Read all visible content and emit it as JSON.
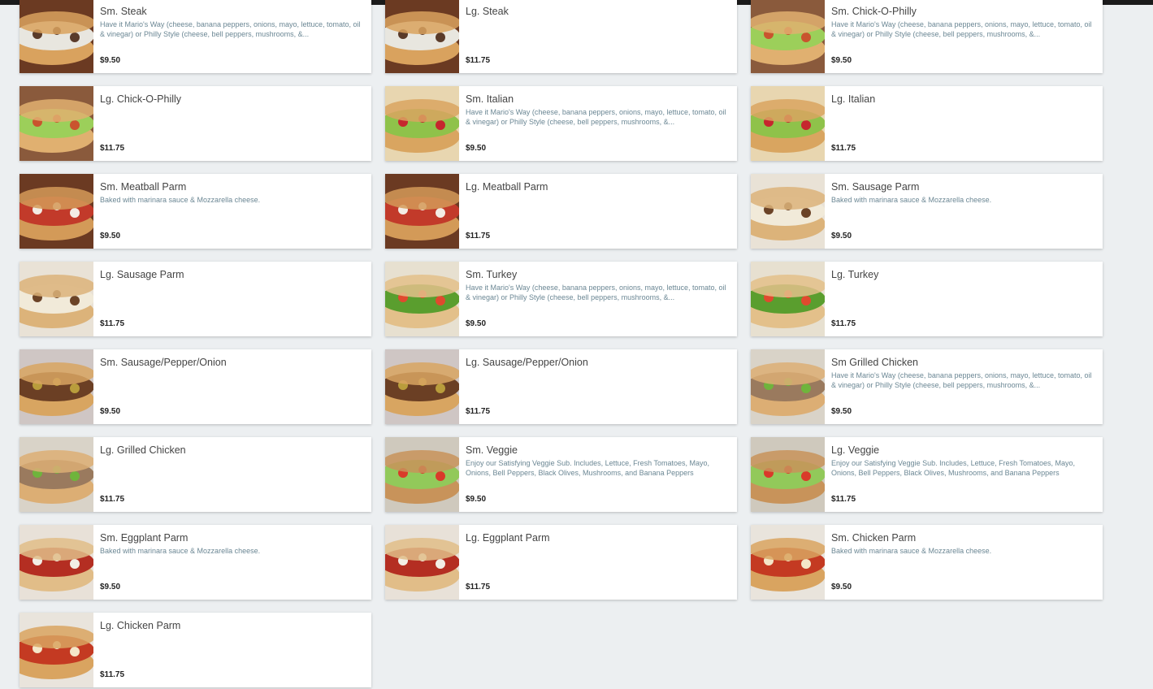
{
  "menu": {
    "items": [
      {
        "name": "Sm. Steak",
        "description": "Have it Mario's Way (cheese, banana peppers, onions, mayo, lettuce, tomato, oil & vinegar) or Philly Style (cheese, bell peppers, mushrooms, &...",
        "price": "$9.50",
        "image": "steak"
      },
      {
        "name": "Lg. Steak",
        "description": "",
        "price": "$11.75",
        "image": "steak"
      },
      {
        "name": "Sm. Chick-O-Philly",
        "description": "Have it Mario's Way (cheese, banana peppers, onions, mayo, lettuce, tomato, oil & vinegar) or Philly Style (cheese, bell peppers, mushrooms, &...",
        "price": "$9.50",
        "image": "chick"
      },
      {
        "name": "Lg. Chick-O-Philly",
        "description": "",
        "price": "$11.75",
        "image": "chick"
      },
      {
        "name": "Sm. Italian",
        "description": "Have it Mario's Way (cheese, banana peppers, onions, mayo, lettuce, tomato, oil & vinegar) or Philly Style (cheese, bell peppers, mushrooms, &...",
        "price": "$9.50",
        "image": "italian"
      },
      {
        "name": "Lg. Italian",
        "description": "",
        "price": "$11.75",
        "image": "italian"
      },
      {
        "name": "Sm. Meatball Parm",
        "description": "Baked with marinara sauce & Mozzarella cheese.",
        "price": "$9.50",
        "image": "meatball"
      },
      {
        "name": "Lg. Meatball Parm",
        "description": "",
        "price": "$11.75",
        "image": "meatball"
      },
      {
        "name": "Sm. Sausage Parm",
        "description": "Baked with marinara sauce & Mozzarella cheese.",
        "price": "$9.50",
        "image": "sausage"
      },
      {
        "name": "Lg. Sausage Parm",
        "description": "",
        "price": "$11.75",
        "image": "sausage"
      },
      {
        "name": "Sm. Turkey",
        "description": "Have it Mario's Way (cheese, banana peppers, onions, mayo, lettuce, tomato, oil & vinegar) or Philly Style (cheese, bell peppers, mushrooms, &...",
        "price": "$9.50",
        "image": "turkey"
      },
      {
        "name": "Lg. Turkey",
        "description": "",
        "price": "$11.75",
        "image": "turkey"
      },
      {
        "name": "Sm. Sausage/Pepper/Onion",
        "description": "",
        "price": "$9.50",
        "image": "spo"
      },
      {
        "name": "Lg. Sausage/Pepper/Onion",
        "description": "",
        "price": "$11.75",
        "image": "spo"
      },
      {
        "name": "Sm Grilled Chicken",
        "description": "Have it Mario's Way (cheese, banana peppers, onions, mayo, lettuce, tomato, oil & vinegar) or Philly Style (cheese, bell peppers, mushrooms, &...",
        "price": "$9.50",
        "image": "grilled"
      },
      {
        "name": "Lg. Grilled Chicken",
        "description": "",
        "price": "$11.75",
        "image": "grilled"
      },
      {
        "name": "Sm. Veggie",
        "description": "Enjoy our Satisfying Veggie Sub. Includes, Lettuce, Fresh Tomatoes, Mayo, Onions, Bell Peppers, Black Olives, Mushrooms, and Banana Peppers",
        "price": "$9.50",
        "image": "veggie"
      },
      {
        "name": "Lg. Veggie",
        "description": "Enjoy our Satisfying Veggie Sub. Includes, Lettuce, Fresh Tomatoes, Mayo, Onions, Bell Peppers, Black Olives, Mushrooms, and Banana Peppers",
        "price": "$11.75",
        "image": "veggie"
      },
      {
        "name": "Sm. Eggplant Parm",
        "description": "Baked with marinara sauce & Mozzarella cheese.",
        "price": "$9.50",
        "image": "eggplant"
      },
      {
        "name": "Lg. Eggplant Parm",
        "description": "",
        "price": "$11.75",
        "image": "eggplant"
      },
      {
        "name": "Sm. Chicken Parm",
        "description": "Baked with marinara sauce & Mozzarella cheese.",
        "price": "$9.50",
        "image": "chickenparm"
      },
      {
        "name": "Lg. Chicken Parm",
        "description": "",
        "price": "$11.75",
        "image": "chickenparm"
      }
    ]
  },
  "colors": {
    "background": "#eceff1",
    "card": "#ffffff",
    "description_text": "#6b8794",
    "top_bar": "#1b1b1b"
  }
}
